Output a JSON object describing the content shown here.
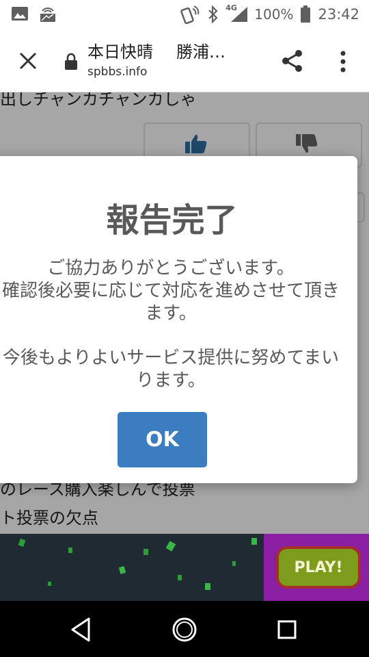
{
  "status_bar": {
    "network": "4G",
    "battery": "100%",
    "time": "23:42"
  },
  "app_bar": {
    "title_part1": "本日快晴",
    "title_part2": "勝浦…",
    "url": "spbbs.info"
  },
  "page": {
    "line_top": "出しチャンカチャンカしゃ",
    "line_bottom_1": "のレース購入楽しんで投票",
    "line_bottom_2": "ト投票の欠点"
  },
  "modal": {
    "title": "報告完了",
    "line1": "ご協力ありがとうございます。",
    "line2": "確認後必要に応じて対応を進めさせて頂き",
    "line3": "ます。",
    "line4": "今後もよりよいサービス提供に努めてまい",
    "line5": "ります。",
    "ok_label": "OK"
  },
  "ad": {
    "play_label": "PLAY!"
  },
  "colors": {
    "ok_button": "#3c7dc2",
    "modal_text": "#595959",
    "like_icon": "#2f6da3"
  }
}
